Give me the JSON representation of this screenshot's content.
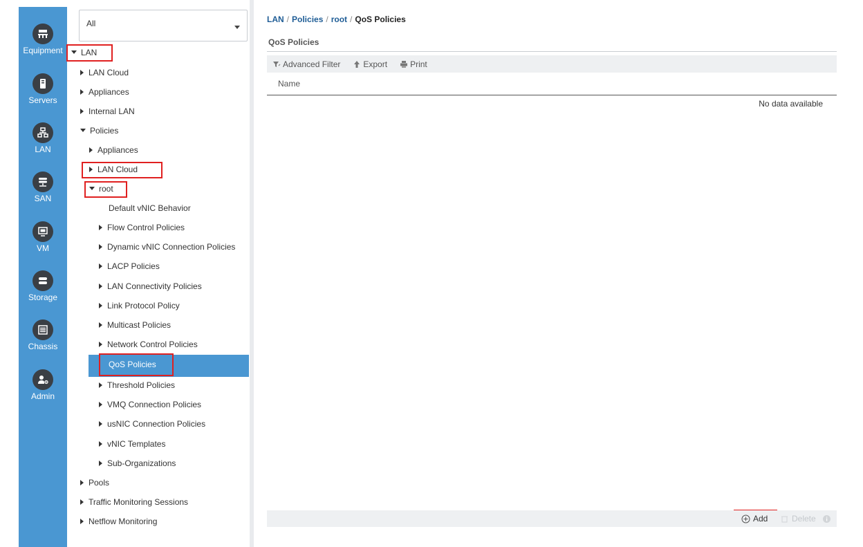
{
  "nav_rail": {
    "items": [
      {
        "label": "Equipment",
        "icon": "equipment-icon"
      },
      {
        "label": "Servers",
        "icon": "servers-icon"
      },
      {
        "label": "LAN",
        "icon": "lan-icon"
      },
      {
        "label": "SAN",
        "icon": "san-icon"
      },
      {
        "label": "VM",
        "icon": "vm-icon"
      },
      {
        "label": "Storage",
        "icon": "storage-icon"
      },
      {
        "label": "Chassis",
        "icon": "chassis-icon"
      },
      {
        "label": "Admin",
        "icon": "admin-icon"
      }
    ],
    "active": "LAN",
    "color": "#4a97d2"
  },
  "filter": {
    "selected": "All"
  },
  "tree": {
    "lan": "LAN",
    "lan_cloud": "LAN Cloud",
    "appliances": "Appliances",
    "internal_lan": "Internal LAN",
    "policies": "Policies",
    "pol_appliances": "Appliances",
    "pol_lan_cloud": "LAN Cloud",
    "root": "root",
    "default_vnic": "Default vNIC Behavior",
    "flow_control": "Flow Control Policies",
    "dynamic_vnic": "Dynamic vNIC Connection Policies",
    "lacp": "LACP Policies",
    "lan_connectivity": "LAN Connectivity Policies",
    "link_protocol": "Link Protocol Policy",
    "multicast": "Multicast Policies",
    "network_control": "Network Control Policies",
    "qos": "QoS Policies",
    "threshold": "Threshold Policies",
    "vmq": "VMQ Connection Policies",
    "usnic": "usNIC Connection Policies",
    "vnic_templates": "vNIC Templates",
    "sub_orgs": "Sub-Organizations",
    "pools": "Pools",
    "traffic_monitoring": "Traffic Monitoring Sessions",
    "netflow": "Netflow Monitoring"
  },
  "breadcrumb": {
    "items": [
      "LAN",
      "Policies",
      "root"
    ],
    "separator": "/",
    "current": "QoS Policies"
  },
  "content": {
    "title": "QoS Policies",
    "toolbar": {
      "advanced_filter": "Advanced Filter",
      "export": "Export",
      "print": "Print"
    },
    "table": {
      "columns": [
        "Name"
      ],
      "empty_text": "No data available"
    },
    "footer": {
      "add": "Add",
      "delete": "Delete"
    }
  },
  "colors": {
    "accent": "#4a97d2",
    "highlight": "#e02020",
    "link": "#1f5d96"
  }
}
